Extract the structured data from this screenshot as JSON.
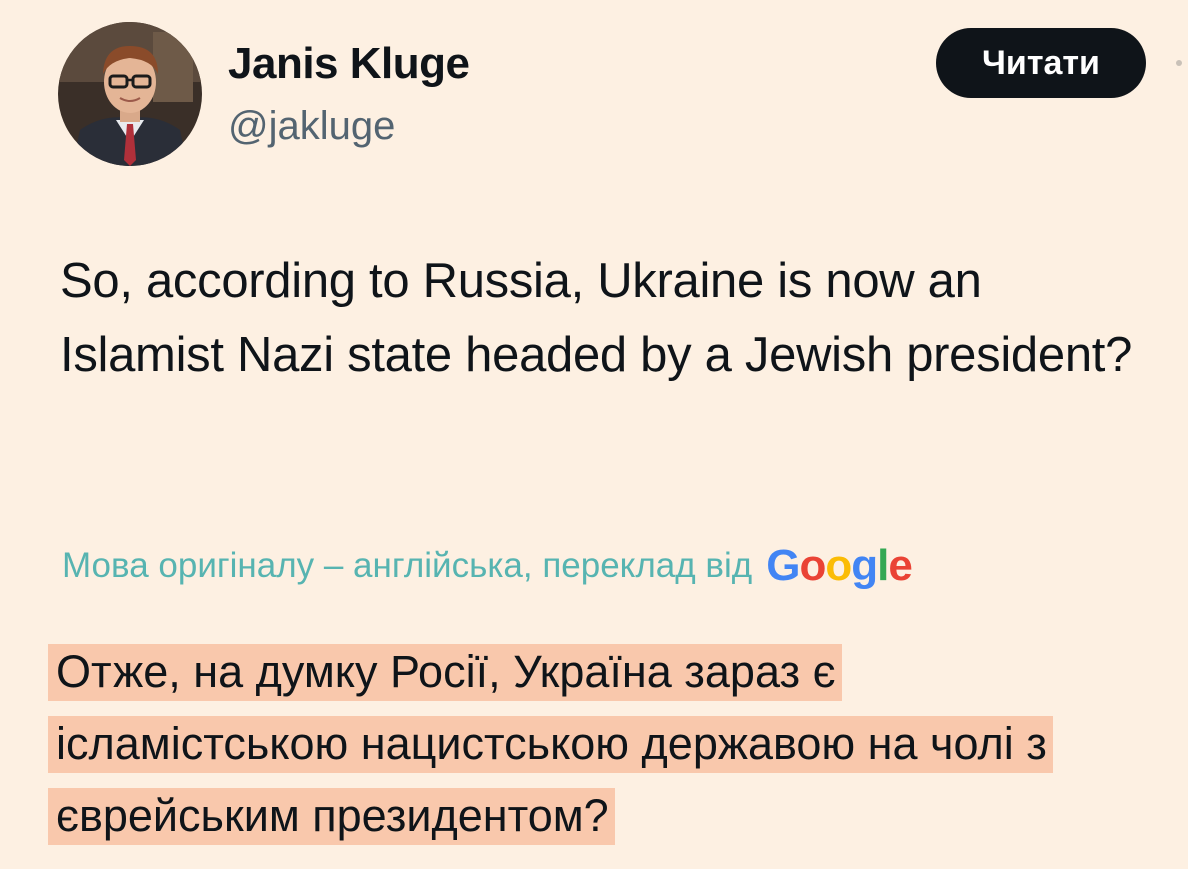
{
  "author": {
    "display_name": "Janis Kluge",
    "handle": "@jakluge"
  },
  "follow_button": {
    "label": "Читати"
  },
  "tweet": {
    "text": "So, according to Russia, Ukraine is now an Islamist Nazi state headed by a Jewish president?"
  },
  "translation": {
    "note": "Мова оригіналу – англійська, переклад від",
    "provider_letters": [
      "G",
      "o",
      "o",
      "g",
      "l",
      "e"
    ],
    "provider_colors": [
      "#4285f4",
      "#ea4335",
      "#fbbc05",
      "#4285f4",
      "#34a853",
      "#ea4335"
    ],
    "lines": [
      "Отже, на думку Росії, Україна зараз є",
      "ісламістською нацистською державою на чолі з",
      "єврейським президентом?"
    ]
  },
  "colors": {
    "background": "#fdf0e2",
    "highlight": "#f9c8ac",
    "translation_note": "#57b4b1",
    "button": "#0f1419"
  }
}
